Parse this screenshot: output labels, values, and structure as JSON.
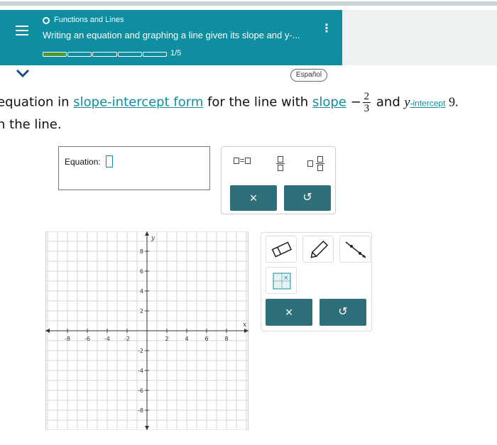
{
  "header": {
    "topic": "Functions and Lines",
    "title": "Writing an equation and graphing a line given its slope and y-...",
    "progress_text": "1/5",
    "progress": {
      "completed": 1,
      "total": 5
    }
  },
  "language_button": "Español",
  "question": {
    "line1_pre": "equation in ",
    "link1": "slope-intercept form",
    "line1_mid": " for the line with ",
    "link2": "slope",
    "slope_sign": "−",
    "slope_num": "2",
    "slope_den": "3",
    "line1_and": " and ",
    "y_var": "y",
    "intercept_link": "-intercept",
    "intercept_value": " 9.",
    "line2": "h the line."
  },
  "equation": {
    "label": "Equation:"
  },
  "toolpanel": {
    "eq_btn_text": "=",
    "clear_label": "×",
    "undo_label": "↺"
  },
  "graph_tools": {
    "clear_label": "×",
    "undo_label": "↺"
  },
  "graph": {
    "x_label": "x",
    "y_label": "y",
    "x_ticks": [
      "-8",
      "-6",
      "-4",
      "-2",
      "2",
      "4",
      "6",
      "8"
    ],
    "y_ticks": [
      "8",
      "6",
      "4",
      "2",
      "-2",
      "-4",
      "-6",
      "-8"
    ],
    "range": [
      -10,
      10
    ]
  },
  "colors": {
    "header": "#0e8ea0",
    "action_button": "#2e6f7a",
    "link": "#0e8ea0",
    "progress_done": "#4b9a3a"
  }
}
